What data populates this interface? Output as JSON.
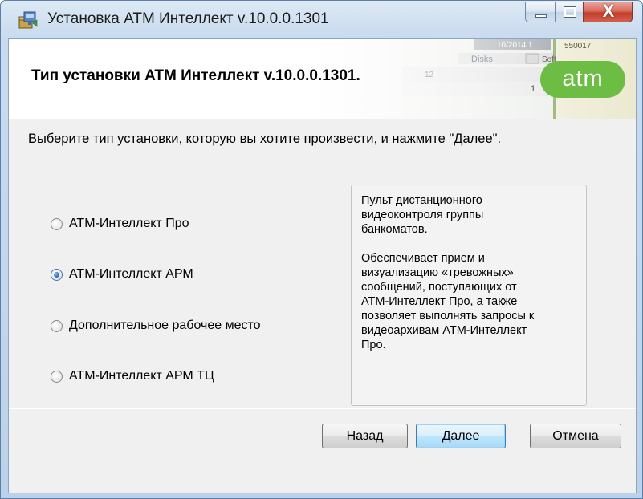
{
  "window": {
    "title": "Установка ATM Интеллект v.10.0.0.1301",
    "controls": {
      "minimize": "minimize",
      "maximize": "maximize",
      "close": "X"
    }
  },
  "banner": {
    "heading": "Тип установки ATM Интеллект v.10.0.0.1301.",
    "logo_text": "atm",
    "background_snippets": {
      "date": "10/2014 1",
      "code": "550017",
      "disks": "Disks",
      "soft": "Soft",
      "num_a": "12",
      "num_b": "1"
    }
  },
  "instruction": "Выберите тип установки, которую вы хотите произвести, и нажмите \"Далее\".",
  "install_types": [
    {
      "label": "АТМ-Интеллект Про",
      "selected": false
    },
    {
      "label": "АТМ-Интеллект АРМ",
      "selected": true
    },
    {
      "label": "Дополнительное рабочее место",
      "selected": false
    },
    {
      "label": "АТМ-Интеллект АРМ ТЦ",
      "selected": false
    }
  ],
  "description": {
    "paragraph_1": "Пульт дистанционного\nвидеоконтроля группы\nбанкоматов.",
    "paragraph_2": "Обеспечивает прием и\nвизуализацию «тревожных»\nсообщений, поступающих от\nАТМ-Интеллект Про, а также\nпозволяет выполнять запросы к\nвидеоархивам АТМ-Интеллект\nПро."
  },
  "buttons": {
    "back": "Назад",
    "next": "Далее",
    "cancel": "Отмена"
  },
  "colors": {
    "logo_green": "#6dbd44",
    "title_bar": "#c9dbef",
    "close_red": "#c23f2c",
    "dialog_bg": "#f0f0f0"
  }
}
